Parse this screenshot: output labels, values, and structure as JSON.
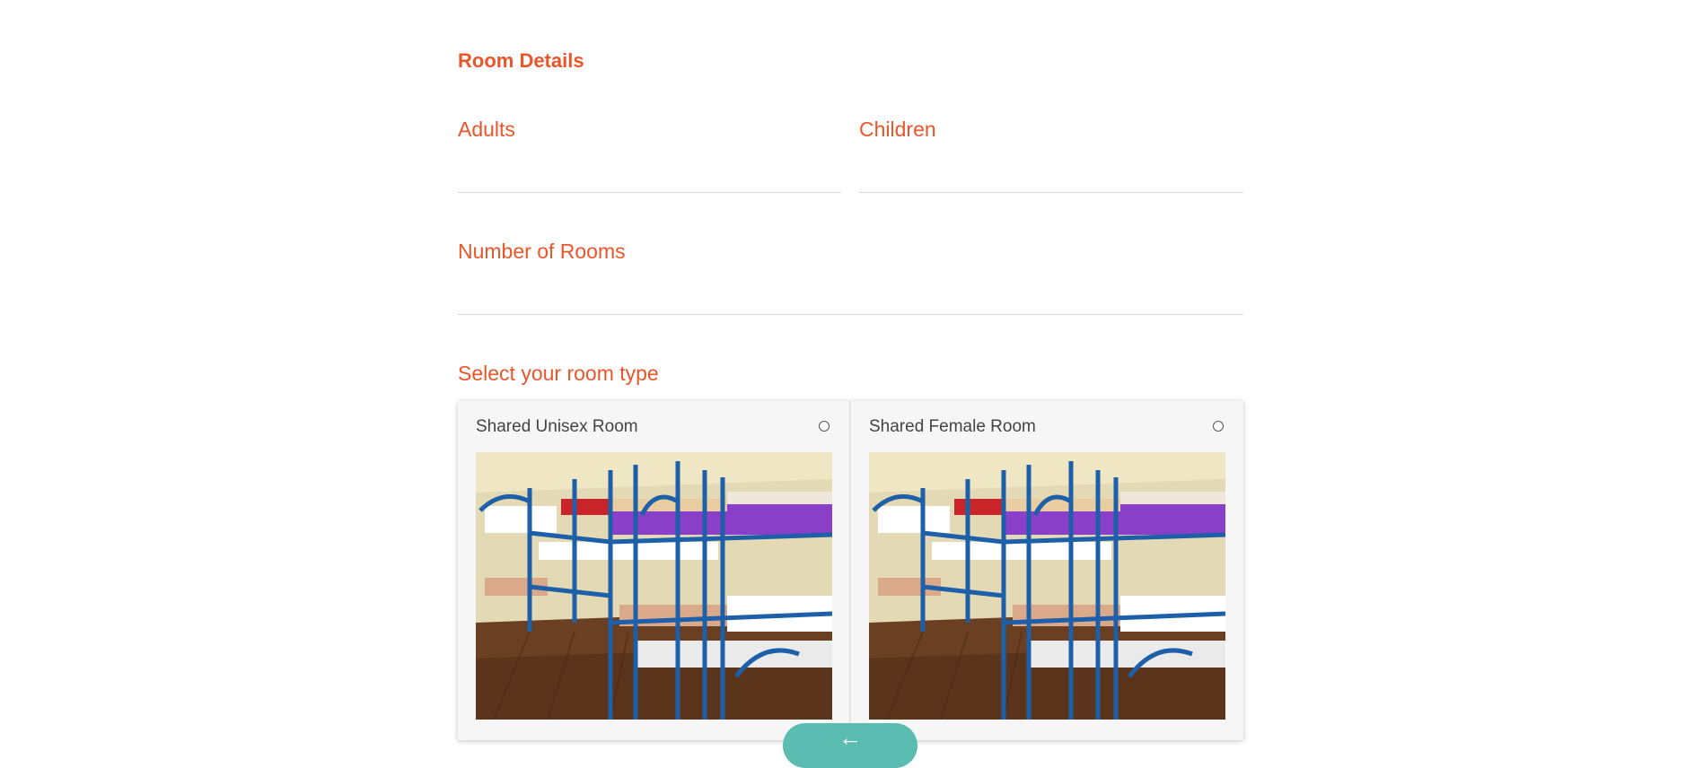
{
  "form": {
    "section_title": "Room Details",
    "adults": {
      "label": "Adults",
      "value": "",
      "placeholder": ""
    },
    "children": {
      "label": "Children",
      "value": "",
      "placeholder": ""
    },
    "rooms": {
      "label": "Number of Rooms",
      "value": "",
      "placeholder": ""
    },
    "room_type_label": "Select your room type",
    "room_types": [
      {
        "name": "Shared Unisex Room",
        "selected": false,
        "image": "bunk-beds-photo"
      },
      {
        "name": "Shared Female Room",
        "selected": false,
        "image": "bunk-beds-photo"
      }
    ]
  },
  "footer": {
    "back_icon": "arrow-left-icon",
    "back_glyph": "←"
  },
  "colors": {
    "accent": "#e8562a",
    "button": "#5bbcb2"
  }
}
